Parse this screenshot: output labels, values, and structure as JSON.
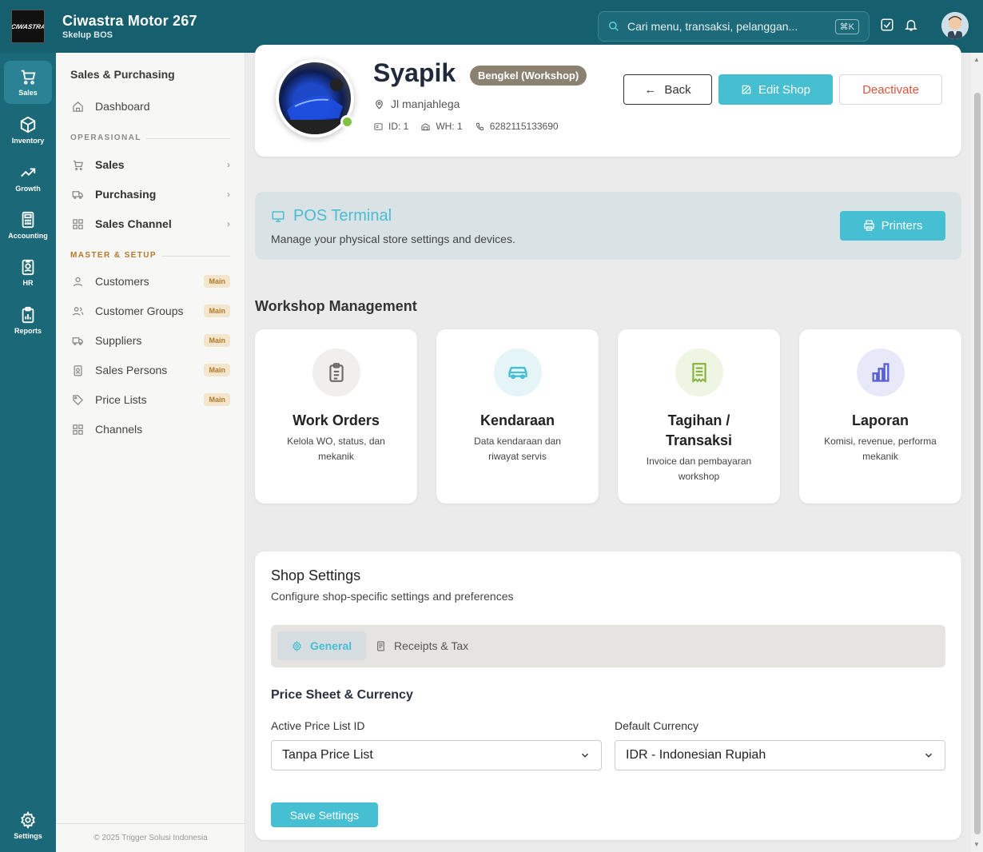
{
  "app": {
    "logo_text": "CIWASTRA",
    "name": "Ciwastra Motor 267",
    "subtitle": "Skelup BOS"
  },
  "search": {
    "placeholder": "Cari menu, transaksi, pelanggan...",
    "shortcut": "⌘K"
  },
  "rail": [
    {
      "label": "Sales",
      "icon": "cart-icon",
      "active": true
    },
    {
      "label": "Inventory",
      "icon": "box-icon"
    },
    {
      "label": "Growth",
      "icon": "trending-up-icon"
    },
    {
      "label": "Accounting",
      "icon": "calculator-icon"
    },
    {
      "label": "HR",
      "icon": "id-badge-icon"
    },
    {
      "label": "Reports",
      "icon": "clipboard-chart-icon"
    },
    {
      "label": "Settings",
      "icon": "gear-icon"
    }
  ],
  "sidebar": {
    "title": "Sales & Purchasing",
    "dashboard": "Dashboard",
    "section_operasional": "OPERASIONAL",
    "operasional": [
      {
        "label": "Sales"
      },
      {
        "label": "Purchasing"
      },
      {
        "label": "Sales Channel"
      }
    ],
    "section_master": "MASTER & SETUP",
    "master": [
      {
        "label": "Customers",
        "badge": "Main"
      },
      {
        "label": "Customer Groups",
        "badge": "Main"
      },
      {
        "label": "Suppliers",
        "badge": "Main"
      },
      {
        "label": "Sales Persons",
        "badge": "Main"
      },
      {
        "label": "Price Lists",
        "badge": "Main"
      },
      {
        "label": "Channels"
      }
    ],
    "footer": "© 2025 Trigger Solusi Indonesia"
  },
  "shop": {
    "name": "Syapik",
    "type_badge": "Bengkel (Workshop)",
    "address": "Jl manjahlega",
    "id": "ID: 1",
    "wh": "WH: 1",
    "phone": "6282115133690",
    "back_label": "Back",
    "edit_label": "Edit Shop",
    "deactivate_label": "Deactivate"
  },
  "pos": {
    "title": "POS Terminal",
    "desc": "Manage your physical store settings and devices.",
    "printers_label": "Printers"
  },
  "workshop": {
    "title": "Workshop Management",
    "tiles": [
      {
        "title": "Work Orders",
        "desc": "Kelola WO, status, dan mekanik",
        "bg": "#f0efed",
        "fg": "#6b6b6b"
      },
      {
        "title": "Kendaraan",
        "desc": "Data kendaraan dan riwayat servis",
        "bg": "#e4f4f7",
        "fg": "#46bfd3"
      },
      {
        "title": "Tagihan / Transaksi",
        "desc": "Invoice dan pembayaran workshop",
        "bg": "#eef5e2",
        "fg": "#87b33e"
      },
      {
        "title": "Laporan",
        "desc": "Komisi, revenue, performa mekanik",
        "bg": "#e8e9f8",
        "fg": "#5960d6"
      }
    ]
  },
  "settings": {
    "title": "Shop Settings",
    "desc": "Configure shop-specific settings and preferences",
    "tab_general": "General",
    "tab_receipts": "Receipts & Tax",
    "section": "Price Sheet & Currency",
    "price_list_label": "Active Price List ID",
    "price_list_value": "Tanpa Price List",
    "currency_label": "Default Currency",
    "currency_value": "IDR - Indonesian Rupiah",
    "save_label": "Save Settings"
  },
  "colors": {
    "topbar": "#155f6e",
    "rail": "#1a6878",
    "accent": "#46bfd3",
    "danger": "#e0533a"
  }
}
